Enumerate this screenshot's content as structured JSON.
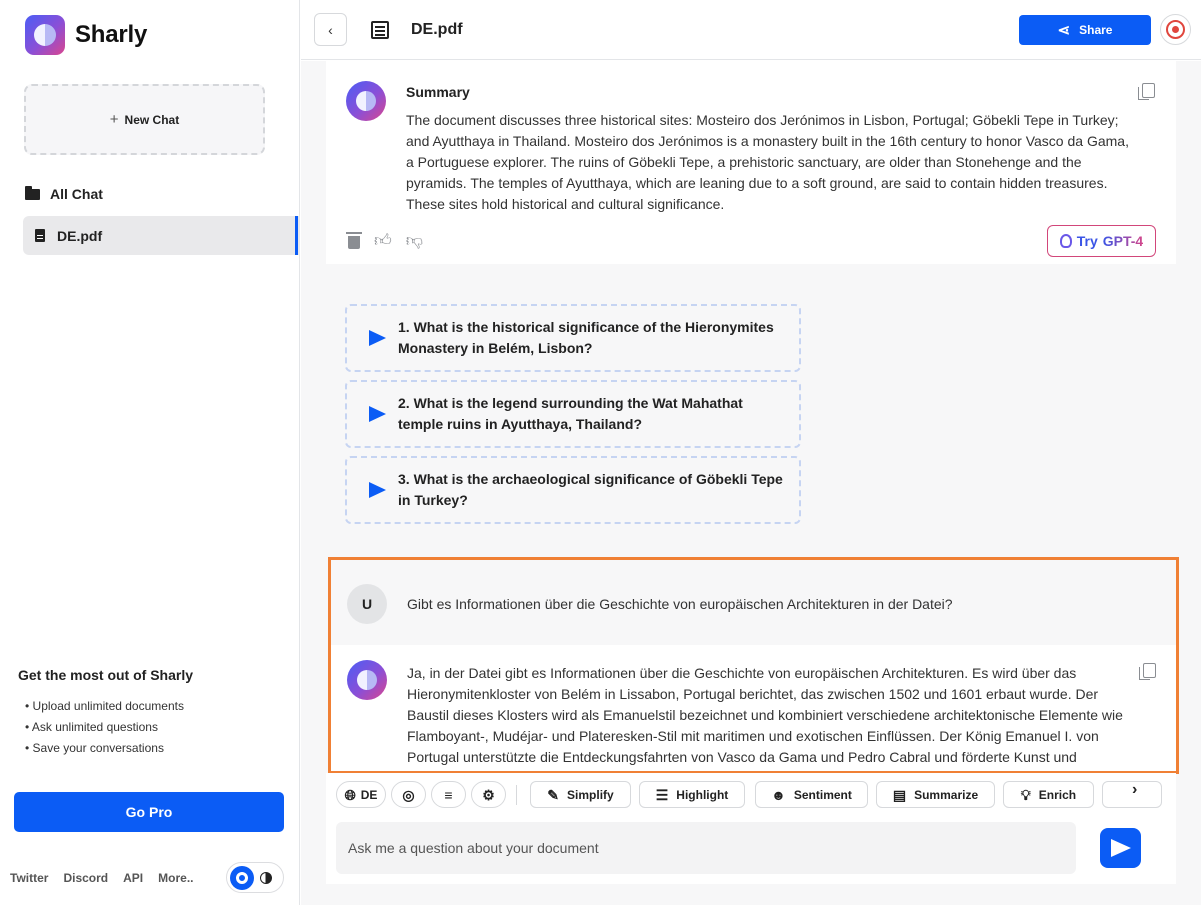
{
  "sidebar": {
    "brand": "Sharly",
    "new_chat_label": "New Chat",
    "all_chat_label": "All Chat",
    "file_label": "DE.pdf",
    "promo_title": "Get the most out of Sharly",
    "promo_items": [
      "• Upload unlimited documents",
      "• Ask unlimited questions",
      "• Save your conversations"
    ],
    "go_pro_label": "Go Pro",
    "footer_links": [
      "Twitter",
      "Discord",
      "API",
      "More.."
    ]
  },
  "header": {
    "back_icon": "chevron-left-icon",
    "doc_title": "DE.pdf",
    "share_label": "Share"
  },
  "summary": {
    "title": "Summary",
    "text": "The document discusses three historical sites: Mosteiro dos Jerónimos in Lisbon, Portugal; Göbekli Tepe in Turkey; and Ayutthaya in Thailand. Mosteiro dos Jerónimos is a monastery built in the 16th century to honor Vasco da Gama, a Portuguese explorer. The ruins of Göbekli Tepe, a prehistoric sanctuary, are older than Stonehenge and the pyramids. The temples of Ayutthaya, which are leaning due to a soft ground, are said to contain hidden treasures. These sites hold historical and cultural significance.",
    "try_gpt_prefix": "Try ",
    "try_gpt_label": "GPT-4"
  },
  "suggestions": [
    "1. What is the historical significance of the Hieronymites Monastery in Belém, Lisbon?",
    "2. What is the legend surrounding the Wat Mahathat temple ruins in Ayutthaya, Thailand?",
    "3. What is the archaeological significance of Göbekli Tepe in Turkey?"
  ],
  "conversation": {
    "user_initial": "U",
    "user_message": "Gibt es Informationen über die Geschichte von europäischen Architekturen in der Datei?",
    "bot_message": "Ja, in der Datei gibt es Informationen über die Geschichte von europäischen Architekturen. Es wird über das Hieronymitenkloster von Belém in Lissabon, Portugal berichtet, das zwischen 1502 und 1601 erbaut wurde. Der Baustil dieses Klosters wird als Emanuelstil bezeichnet und kombiniert verschiedene architektonische Elemente wie Flamboyant-, Mudéjar- und Plateresken-Stil mit maritimen und exotischen Einflüssen. Der König Emanuel I. von Portugal unterstützte die Entdeckungsfahrten von Vasco da Gama und Pedro Cabral und förderte Kunst und"
  },
  "toolbar": {
    "language_label": "DE",
    "simplify_label": "Simplify",
    "highlight_label": "Highlight",
    "sentiment_label": "Sentiment",
    "summarize_label": "Summarize",
    "enrich_label": "Enrich"
  },
  "input": {
    "placeholder": "Ask me a question about your document"
  },
  "colors": {
    "accent": "#0b5cf5",
    "highlight_border": "#f08035",
    "gpt_gradient_start": "#3b55e6",
    "gpt_gradient_end": "#d4468a"
  }
}
